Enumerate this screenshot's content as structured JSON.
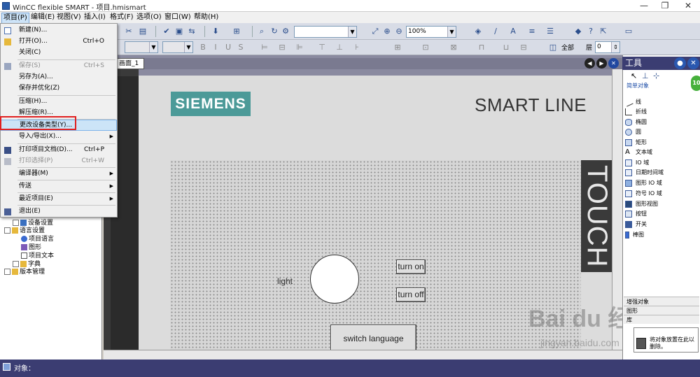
{
  "window": {
    "title": "WinCC flexible SMART - 项目.hmismart",
    "min": "—",
    "restore": "❐",
    "close": "✕"
  },
  "menubar": [
    "项目(P)",
    "编辑(E)",
    "视图(V)",
    "插入(I)",
    "格式(F)",
    "选项(O)",
    "窗口(W)",
    "帮助(H)"
  ],
  "toolbar": {
    "zoom": "100%",
    "font_label": "全部",
    "layer_label": "层",
    "layer_value": "0"
  },
  "project_menu": [
    {
      "label": "新建(N)...",
      "shortcut": "",
      "disabled": false,
      "submenu": false,
      "icon": "new-icon"
    },
    {
      "label": "打开(O)...",
      "shortcut": "Ctrl+O",
      "disabled": false,
      "submenu": false,
      "icon": "open-icon"
    },
    {
      "label": "关闭(C)",
      "shortcut": "",
      "disabled": false,
      "submenu": false,
      "icon": ""
    },
    {
      "label": "保存(S)",
      "shortcut": "Ctrl+S",
      "disabled": true,
      "submenu": false,
      "icon": "save-icon"
    },
    {
      "label": "另存为(A)...",
      "shortcut": "",
      "disabled": false,
      "submenu": false,
      "icon": ""
    },
    {
      "label": "保存并优化(Z)",
      "shortcut": "",
      "disabled": false,
      "submenu": false,
      "icon": ""
    },
    {
      "label": "压缩(H)...",
      "shortcut": "",
      "disabled": false,
      "submenu": false,
      "icon": ""
    },
    {
      "label": "解压缩(R)...",
      "shortcut": "",
      "disabled": false,
      "submenu": false,
      "icon": ""
    },
    {
      "label": "更改设备类型(Y)...",
      "shortcut": "",
      "disabled": false,
      "submenu": false,
      "icon": "",
      "selected": true
    },
    {
      "label": "导入/导出(X)...",
      "shortcut": "",
      "disabled": false,
      "submenu": true,
      "icon": ""
    },
    {
      "label": "打印项目文档(D)...",
      "shortcut": "Ctrl+P",
      "disabled": false,
      "submenu": false,
      "icon": "print-icon"
    },
    {
      "label": "打印选择(P)",
      "shortcut": "Ctrl+W",
      "disabled": true,
      "submenu": false,
      "icon": "print-selection-icon"
    },
    {
      "label": "编译器(M)",
      "shortcut": "",
      "disabled": false,
      "submenu": true,
      "icon": ""
    },
    {
      "label": "传送",
      "shortcut": "",
      "disabled": false,
      "submenu": true,
      "icon": ""
    },
    {
      "label": "最近项目(E)",
      "shortcut": "",
      "disabled": false,
      "submenu": true,
      "icon": ""
    },
    {
      "label": "退出(E)",
      "shortcut": "",
      "disabled": false,
      "submenu": false,
      "icon": "exit-icon"
    }
  ],
  "project_tree": [
    {
      "label": "设备设置",
      "level": 2
    },
    {
      "label": "语言设置",
      "level": 1
    },
    {
      "label": "项目语言",
      "level": 2
    },
    {
      "label": "图形",
      "level": 2
    },
    {
      "label": "项目文本",
      "level": 2
    },
    {
      "label": "字典",
      "level": 2
    },
    {
      "label": "版本管理",
      "level": 1
    }
  ],
  "editor": {
    "tab": "画面_1",
    "brand": "SIEMENS",
    "device_line": "SMART LINE",
    "side_label": "TOUCH",
    "light_label": "light",
    "btn_on": "turn on",
    "btn_off": "turn off",
    "btn_lang": "switch language"
  },
  "tools": {
    "title": "工具",
    "group": "简单对象",
    "items": [
      "线",
      "折线",
      "椭圆",
      "圆",
      "矩形",
      "文本域",
      "IO 域",
      "日期时间域",
      "图形 IO 域",
      "符号 IO 域",
      "图形视图",
      "按钮",
      "开关",
      "棒图"
    ],
    "sections": [
      "增强对象",
      "图形",
      "库"
    ],
    "hint": "将对象放置在此以删除。",
    "badge": "10"
  },
  "status": {
    "label": "对象："
  },
  "watermark": {
    "main": "Bai du 经验",
    "sub": "jingyan.baidu.com"
  }
}
